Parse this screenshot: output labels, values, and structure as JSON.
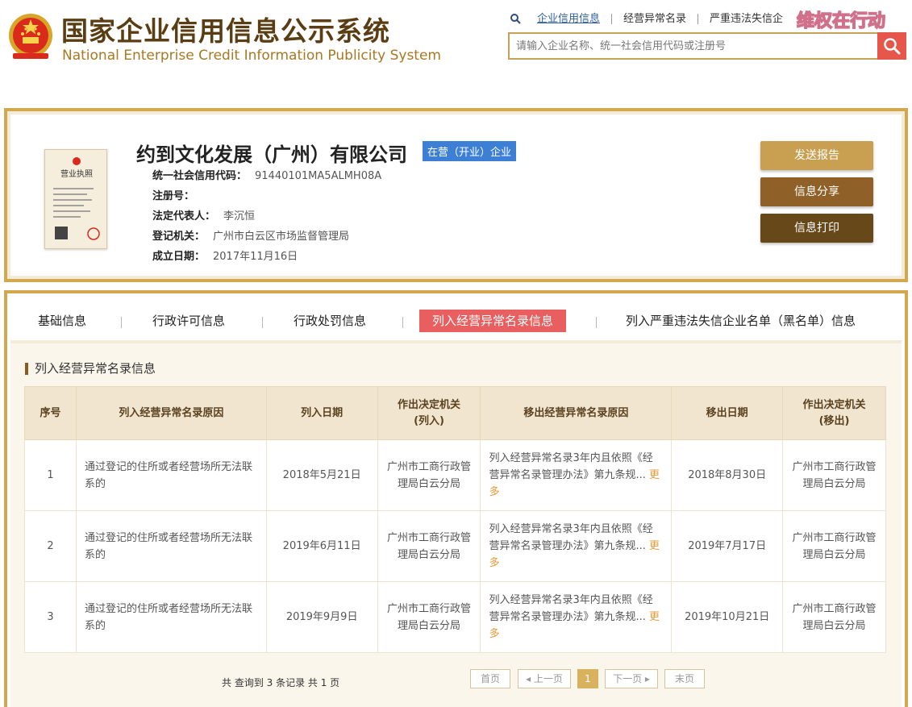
{
  "header": {
    "title_cn": "国家企业信用信息公示系统",
    "title_en": "National Enterprise Credit Information Publicity System",
    "nav": [
      "企业信用信息",
      "经营异常名录",
      "严重违法失信企"
    ],
    "search_placeholder": "请输入企业名称、统一社会信用代码或注册号",
    "watermark": "维权在行动"
  },
  "company": {
    "name": "约到文化发展（广州）有限公司",
    "status": "在营（开业）企业",
    "fields": [
      {
        "label": "统一社会信用代码：",
        "value": "91440101MA5ALMH08A"
      },
      {
        "label": "注册号：",
        "value": ""
      },
      {
        "label": "法定代表人：",
        "value": "李沉恒"
      },
      {
        "label": "登记机关：",
        "value": "广州市白云区市场监督管理局"
      },
      {
        "label": "成立日期：",
        "value": "2017年11月16日"
      }
    ],
    "license_title": "营业执照",
    "buttons": {
      "report": "发送报告",
      "share": "信息分享",
      "print": "信息打印"
    }
  },
  "tabs": [
    "基础信息",
    "行政许可信息",
    "行政处罚信息",
    "列入经营异常名录信息",
    "列入严重违法失信企业名单（黑名单）信息"
  ],
  "section_title": "列入经营异常名录信息",
  "table": {
    "headers": [
      "序号",
      "列入经营异常名录原因",
      "列入日期",
      "作出决定机关\n(列入)",
      "移出经营异常名录原因",
      "移出日期",
      "作出决定机关\n(移出)"
    ],
    "rows": [
      {
        "no": "1",
        "reason": "通过登记的住所或者经营场所无法联系的",
        "date_in": "2018年5月21日",
        "org_in": "广州市工商行政管理局白云分局",
        "reason_out": "列入经营异常名录3年内且依照《经营异常名录管理办法》第九条规...",
        "date_out": "2018年8月30日",
        "org_out": "广州市工商行政管理局白云分局"
      },
      {
        "no": "2",
        "reason": "通过登记的住所或者经营场所无法联系的",
        "date_in": "2019年6月11日",
        "org_in": "广州市工商行政管理局白云分局",
        "reason_out": "列入经营异常名录3年内且依照《经营异常名录管理办法》第九条规...",
        "date_out": "2019年7月17日",
        "org_out": "广州市工商行政管理局白云分局"
      },
      {
        "no": "3",
        "reason": "通过登记的住所或者经营场所无法联系的",
        "date_in": "2019年9月9日",
        "org_in": "广州市工商行政管理局白云分局",
        "reason_out": "列入经营异常名录3年内且依照《经营异常名录管理办法》第九条规...",
        "date_out": "2019年10月21日",
        "org_out": "广州市工商行政管理局白云分局"
      }
    ],
    "more_label": "更多"
  },
  "pager": {
    "info": "共 查询到 3 条记录 共 1 页",
    "first": "首页",
    "prev": "◂ 上一页",
    "current": "1",
    "next": "下一页 ▸",
    "last": "末页"
  },
  "colors": {
    "gold": "#d2a84e",
    "brown": "#5a3d12",
    "accent_red": "#e95f5f",
    "status_blue": "#3d7fd5"
  }
}
